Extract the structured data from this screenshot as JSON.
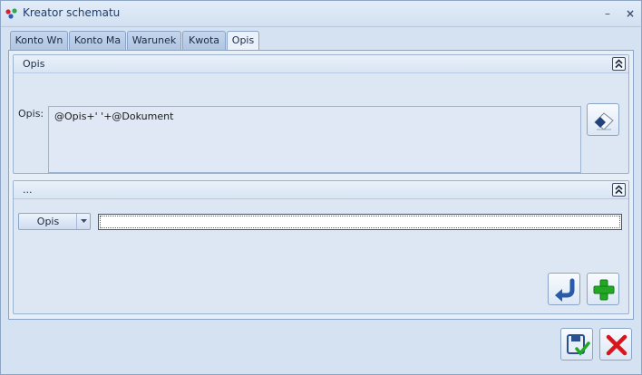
{
  "window": {
    "title": "Kreator schematu",
    "minimize_glyph": "–",
    "close_glyph": "×"
  },
  "tabs": [
    {
      "label": "Konto Wn",
      "active": false
    },
    {
      "label": "Konto Ma",
      "active": false
    },
    {
      "label": "Warunek",
      "active": false
    },
    {
      "label": "Kwota",
      "active": false
    },
    {
      "label": "Opis",
      "active": true
    }
  ],
  "group_opis": {
    "title": "Opis",
    "field_label": "Opis:",
    "field_value": "@Opis+' '+@Dokument",
    "edit_icon": "eraser-icon"
  },
  "group_builder": {
    "title": "...",
    "dropdown_value": "Opis",
    "input_value": "",
    "insert_icon": "insert-arrow-icon",
    "add_icon": "plus-icon"
  },
  "footer": {
    "save_icon": "save-check-icon",
    "cancel_icon": "red-x-icon"
  },
  "colors": {
    "window_bg": "#d5e2f1",
    "accent_blue": "#2a5aa8",
    "add_green": "#22a824",
    "cancel_red": "#d8141c"
  }
}
